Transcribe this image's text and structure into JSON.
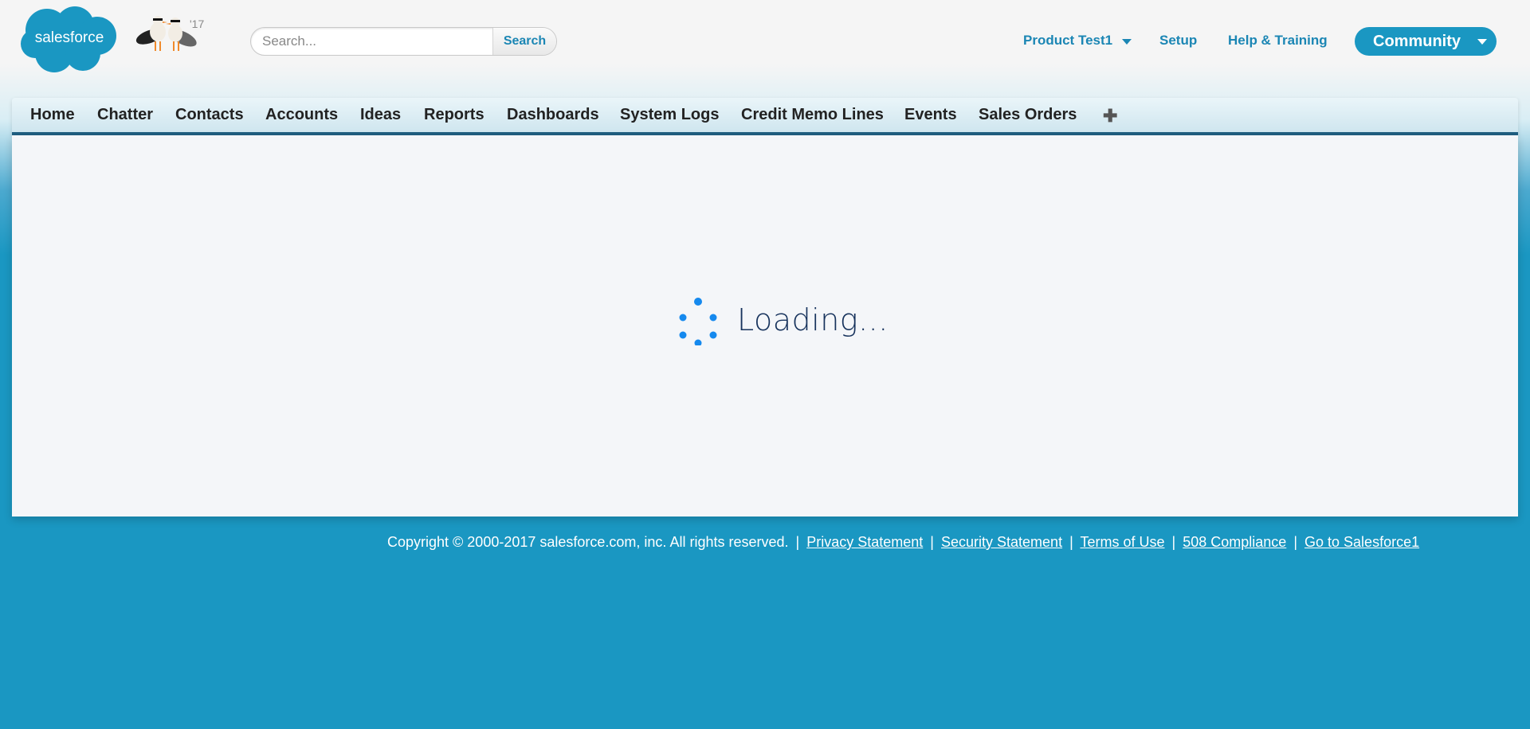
{
  "header": {
    "logo_text": "salesforce",
    "mascot_year": "'17",
    "search": {
      "placeholder": "Search...",
      "button_label": "Search"
    },
    "links": {
      "product": "Product Test1",
      "setup": "Setup",
      "help": "Help & Training"
    },
    "community_label": "Community"
  },
  "tabs": [
    "Home",
    "Chatter",
    "Contacts",
    "Accounts",
    "Ideas",
    "Reports",
    "Dashboards",
    "System Logs",
    "Credit Memo Lines",
    "Events",
    "Sales Orders"
  ],
  "tab_plus": "✚",
  "content": {
    "loading_text": "Loading..."
  },
  "footer": {
    "copyright": "Copyright © 2000-2017 salesforce.com, inc. All rights reserved.",
    "separator": "|",
    "links": [
      "Privacy Statement",
      "Security Statement",
      "Terms of Use",
      "508 Compliance",
      "Go to Salesforce1"
    ]
  },
  "colors": {
    "brand_blue": "#1a97c2",
    "link_blue": "#1b86b4",
    "spinner_blue": "#1589ee",
    "tab_border": "#1f5f82"
  },
  "icons": {
    "logo": "salesforce-cloud-logo",
    "mascot": "seagulls-mascot",
    "spinner": "loading-spinner-icon",
    "product_caret": "chevron-down-icon",
    "community_caret": "chevron-down-icon",
    "add_tab": "plus-icon"
  }
}
